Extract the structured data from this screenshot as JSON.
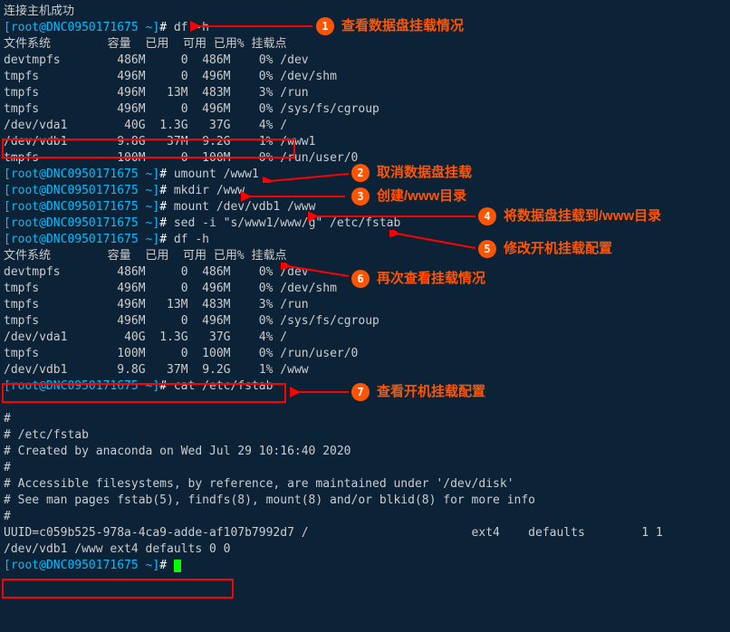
{
  "status": "连接主机成功",
  "host": "root@DNC0950171675",
  "commands": {
    "df1": "df -h",
    "umount": "umount /www1",
    "mkdir": "mkdir /www",
    "mount": "mount /dev/vdb1 /www",
    "sed": "sed -i \"s/www1/www/g\" /etc/fstab",
    "df2": "df -h",
    "cat": "cat /etc/fstab"
  },
  "df_header": {
    "fs": "文件系统",
    "size": "容量",
    "used": "已用",
    "avail": "可用",
    "usepct": "已用%",
    "mount": "挂载点"
  },
  "df1_rows": [
    {
      "fs": "devtmpfs",
      "size": "486M",
      "used": "0",
      "avail": "486M",
      "pct": "0%",
      "mnt": "/dev"
    },
    {
      "fs": "tmpfs",
      "size": "496M",
      "used": "0",
      "avail": "496M",
      "pct": "0%",
      "mnt": "/dev/shm"
    },
    {
      "fs": "tmpfs",
      "size": "496M",
      "used": "13M",
      "avail": "483M",
      "pct": "3%",
      "mnt": "/run"
    },
    {
      "fs": "tmpfs",
      "size": "496M",
      "used": "0",
      "avail": "496M",
      "pct": "0%",
      "mnt": "/sys/fs/cgroup"
    },
    {
      "fs": "/dev/vda1",
      "size": "40G",
      "used": "1.3G",
      "avail": "37G",
      "pct": "4%",
      "mnt": "/"
    },
    {
      "fs": "/dev/vdb1",
      "size": "9.8G",
      "used": "37M",
      "avail": "9.2G",
      "pct": "1%",
      "mnt": "/www1"
    },
    {
      "fs": "tmpfs",
      "size": "100M",
      "used": "0",
      "avail": "100M",
      "pct": "0%",
      "mnt": "/run/user/0"
    }
  ],
  "df2_rows": [
    {
      "fs": "devtmpfs",
      "size": "486M",
      "used": "0",
      "avail": "486M",
      "pct": "0%",
      "mnt": "/dev"
    },
    {
      "fs": "tmpfs",
      "size": "496M",
      "used": "0",
      "avail": "496M",
      "pct": "0%",
      "mnt": "/dev/shm"
    },
    {
      "fs": "tmpfs",
      "size": "496M",
      "used": "13M",
      "avail": "483M",
      "pct": "3%",
      "mnt": "/run"
    },
    {
      "fs": "tmpfs",
      "size": "496M",
      "used": "0",
      "avail": "496M",
      "pct": "0%",
      "mnt": "/sys/fs/cgroup"
    },
    {
      "fs": "/dev/vda1",
      "size": "40G",
      "used": "1.3G",
      "avail": "37G",
      "pct": "4%",
      "mnt": "/"
    },
    {
      "fs": "tmpfs",
      "size": "100M",
      "used": "0",
      "avail": "100M",
      "pct": "0%",
      "mnt": "/run/user/0"
    },
    {
      "fs": "/dev/vdb1",
      "size": "9.8G",
      "used": "37M",
      "avail": "9.2G",
      "pct": "1%",
      "mnt": "/www"
    }
  ],
  "fstab": {
    "l1": "#",
    "l2": "# /etc/fstab",
    "l3": "# Created by anaconda on Wed Jul 29 10:16:40 2020",
    "l4": "#",
    "l5": "# Accessible filesystems, by reference, are maintained under '/dev/disk'",
    "l6": "# See man pages fstab(5), findfs(8), mount(8) and/or blkid(8) for more info",
    "l7": "#",
    "l8": "UUID=c059b525-978a-4ca9-adde-af107b7992d7 /                       ext4    defaults        1 1",
    "l9": "/dev/vdb1 /www ext4 defaults 0 0"
  },
  "annotations": {
    "a1": "查看数据盘挂载情况",
    "a2": "取消数据盘挂载",
    "a3": "创建/www目录",
    "a4": "将数据盘挂载到/www目录",
    "a5": "修改开机挂载配置",
    "a6": "再次查看挂载情况",
    "a7": "查看开机挂载配置"
  },
  "badges": {
    "b1": "1",
    "b2": "2",
    "b3": "3",
    "b4": "4",
    "b5": "5",
    "b6": "6",
    "b7": "7"
  }
}
